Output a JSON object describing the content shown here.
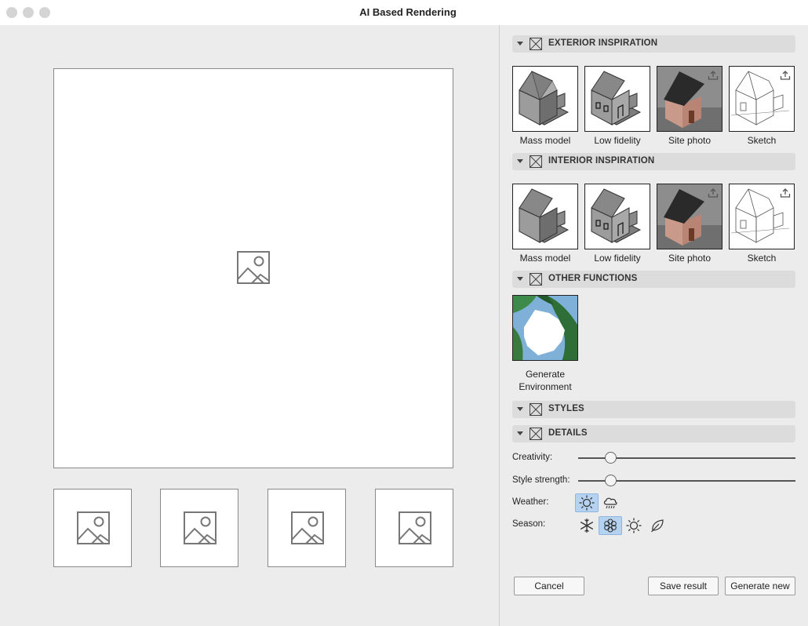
{
  "window": {
    "title": "AI Based Rendering"
  },
  "sections": {
    "exterior": "EXTERIOR INSPIRATION",
    "interior": "INTERIOR INSPIRATION",
    "other": "OTHER FUNCTIONS",
    "styles": "STYLES",
    "details": "DETAILS"
  },
  "exterior_tiles": [
    "Mass model",
    "Low fidelity",
    "Site photo",
    "Sketch"
  ],
  "interior_tiles": [
    "Mass model",
    "Low fidelity",
    "Site photo",
    "Sketch"
  ],
  "other_functions": {
    "line1": "Generate",
    "line2": "Environment"
  },
  "details": {
    "creativity_label": "Creativity:",
    "creativity_value": 0.13,
    "style_strength_label": "Style strength:",
    "style_strength_value": 0.13,
    "weather_label": "Weather:",
    "weather_options": [
      "sun-icon",
      "rain-cloud-icon"
    ],
    "weather_selected": "sun-icon",
    "season_label": "Season:",
    "season_options": [
      "snowflake-icon",
      "flower-icon",
      "sun-icon",
      "leaf-icon"
    ],
    "season_selected": "flower-icon"
  },
  "buttons": {
    "cancel": "Cancel",
    "save": "Save result",
    "generate": "Generate new"
  },
  "colors": {
    "selection": "#b5d3f0",
    "panel": "#ececec",
    "section_header": "#dcdcdc"
  }
}
